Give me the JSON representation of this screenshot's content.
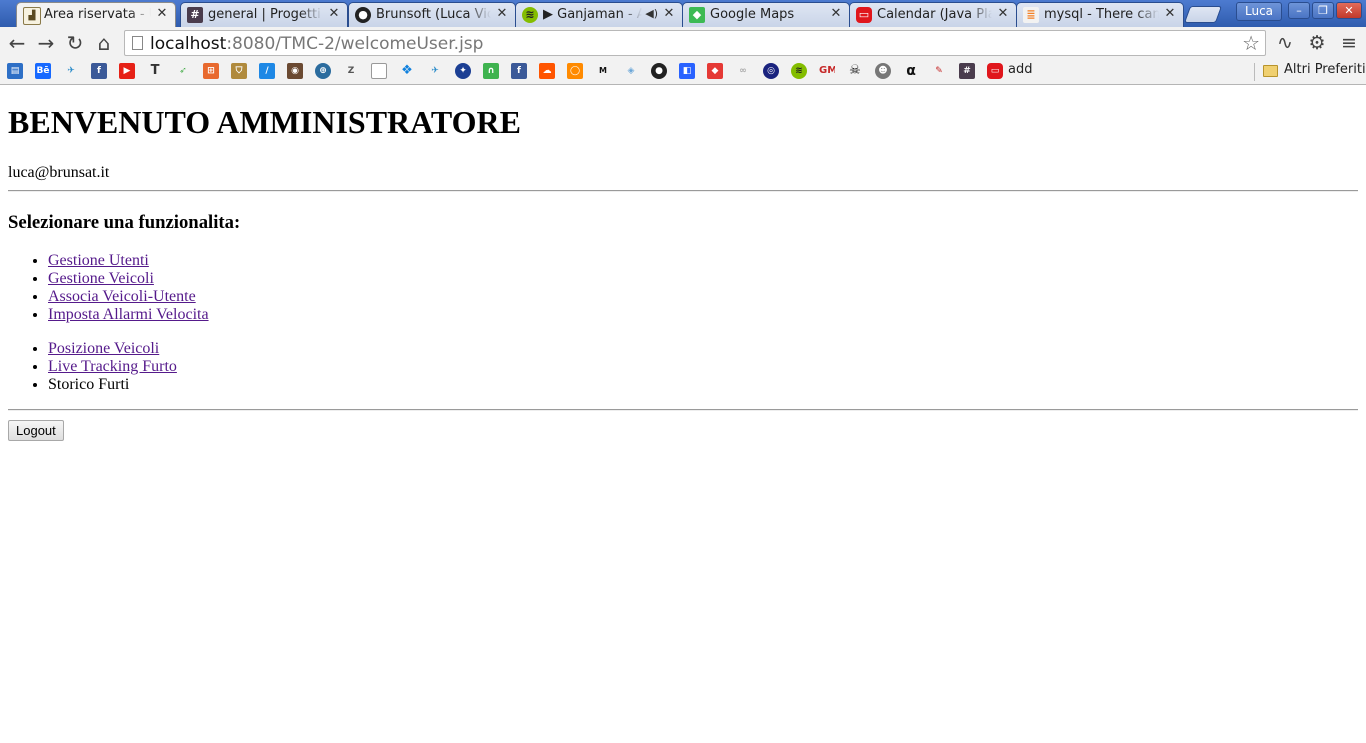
{
  "browser": {
    "tabs": [
      {
        "title": "Area riservata - Utente",
        "favicon": "page-icon",
        "active": true
      },
      {
        "title": "general | Progetti Slack",
        "favicon": "slack-hash-icon"
      },
      {
        "title": "Brunsoft (Luca Vicidomini)",
        "favicon": "github-icon"
      },
      {
        "title": "▶ Ganjaman - Alla fine",
        "favicon": "spotify-icon",
        "audio": true
      },
      {
        "title": "Google Maps",
        "favicon": "google-maps-icon"
      },
      {
        "title": "Calendar (Java Platform SE)",
        "favicon": "oracle-icon"
      },
      {
        "title": "mysql - There can be only one",
        "favicon": "stackoverflow-icon"
      }
    ],
    "profile_name": "Luca",
    "url_host": "localhost",
    "url_path": ":8080/TMC-2/welcomeUser.jsp",
    "bookmarks": {
      "add_label": "add",
      "other_bookmarks_label": "Altri Preferiti"
    }
  },
  "page": {
    "heading": "BENVENUTO AMMINISTRATORE",
    "user_email": "luca@brunsat.it",
    "subheading": "Selezionare una funzionalita:",
    "menu_group_1": [
      {
        "label": "Gestione Utenti",
        "link": true
      },
      {
        "label": "Gestione Veicoli",
        "link": true
      },
      {
        "label": "Associa Veicoli-Utente",
        "link": true
      },
      {
        "label": "Imposta Allarmi Velocita",
        "link": true
      }
    ],
    "menu_group_2": [
      {
        "label": "Posizione Veicoli",
        "link": true
      },
      {
        "label": "Live Tracking Furto",
        "link": true
      },
      {
        "label": "Storico Furti",
        "link": false
      }
    ],
    "logout_label": "Logout",
    "link_color": "#551a8b"
  }
}
